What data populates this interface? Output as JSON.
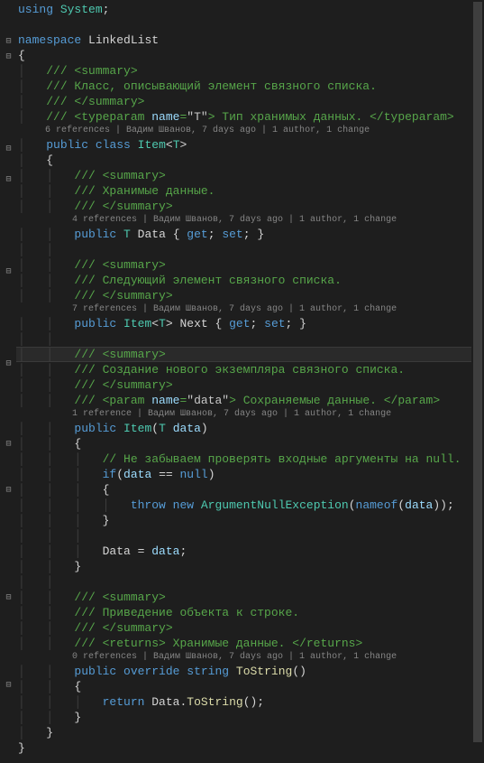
{
  "code": {
    "using": "using",
    "system": "System",
    "namespace_kw": "namespace",
    "namespace_name": "LinkedList",
    "public": "public",
    "class_kw": "class",
    "class_name": "Item",
    "generic": "T",
    "override": "override",
    "string_type": "string",
    "return": "return",
    "if": "if",
    "throw": "throw",
    "new": "new",
    "null": "null",
    "nameof": "nameof",
    "get": "get",
    "set": "set",
    "data_prop": "Data",
    "next_prop": "Next",
    "tostring": "ToString",
    "ctor_param": "data",
    "exc": "ArgumentNullException"
  },
  "comments": {
    "summary_open": "/// <summary>",
    "summary_close": "/// </summary>",
    "c1": "/// Класс, описывающий элемент связного списка.",
    "tp_open": "/// <typeparam ",
    "tp_name": "name",
    "tp_val": "\"T\"",
    "tp_mid": "> Тип хранимых данных. </typeparam>",
    "c2": "/// Хранимые данные.",
    "c3": "/// Следующий элемент связного списка.",
    "c4": "/// Создание нового экземпляра связного списка.",
    "param_open": "/// <param ",
    "param_val": "\"data\"",
    "param_mid": "> Сохраняемые данные. </param>",
    "c5": "// Не забываем проверять входные аргументы на null.",
    "c6": "/// Приведение объекта к строке.",
    "ret_tag": "/// <returns> Хранимые данные. </returns>"
  },
  "codelens": {
    "l1": "6 references | Вадим Шванов, 7 days ago | 1 author, 1 change",
    "l2": "4 references | Вадим Шванов, 7 days ago | 1 author, 1 change",
    "l3": "7 references | Вадим Шванов, 7 days ago | 1 author, 1 change",
    "l4": "1 reference | Вадим Шванов, 7 days ago | 1 author, 1 change",
    "l5": "0 references | Вадим Шванов, 7 days ago | 1 author, 1 change"
  },
  "fold_positions": [
    41,
    58,
    160,
    194,
    296,
    398,
    487,
    538,
    657,
    754
  ]
}
